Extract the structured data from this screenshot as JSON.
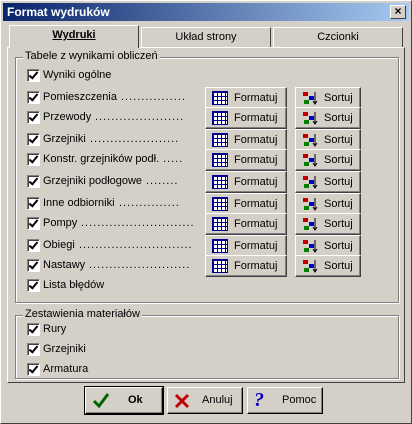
{
  "window": {
    "title": "Format wydruków",
    "close_glyph": "×"
  },
  "tabs": [
    {
      "label": "Wydruki"
    },
    {
      "label": "Układ strony"
    },
    {
      "label": "Czcionki"
    }
  ],
  "group_tables": {
    "title": "Tabele z wynikami obliczeń",
    "rows": [
      {
        "label": "Wyniki ogólne",
        "checked": true,
        "buttons": false
      },
      {
        "label": "Pomieszczenia",
        "checked": true,
        "buttons": true,
        "dots": "................"
      },
      {
        "label": "Przewody",
        "checked": true,
        "buttons": true,
        "dots": "......................"
      },
      {
        "label": "Grzejniki",
        "checked": true,
        "buttons": true,
        "dots": "......................"
      },
      {
        "label": "Konstr. grzejników podł.",
        "checked": true,
        "buttons": true,
        "dots": "....."
      },
      {
        "label": "Grzejniki podłogowe",
        "checked": true,
        "buttons": true,
        "dots": "........"
      },
      {
        "label": "Inne odbiorniki",
        "checked": true,
        "buttons": true,
        "dots": "..............."
      },
      {
        "label": "Pompy",
        "checked": true,
        "buttons": true,
        "dots": "............................"
      },
      {
        "label": "Obiegi",
        "checked": true,
        "buttons": true,
        "dots": "............................"
      },
      {
        "label": "Nastawy",
        "checked": true,
        "buttons": true,
        "dots": "........................."
      },
      {
        "label": "Lista błędów",
        "checked": true,
        "buttons": false
      }
    ],
    "format_label": "Formatuj",
    "sort_label": "Sortuj"
  },
  "group_materials": {
    "title": "Zestawienia materiałów",
    "rows": [
      {
        "label": "Rury",
        "checked": true
      },
      {
        "label": "Grzejniki",
        "checked": true
      },
      {
        "label": "Armatura",
        "checked": true
      }
    ]
  },
  "footer": {
    "ok_label": "Ok",
    "cancel_label": "Anuluj",
    "help_label": "Pomoc",
    "ok_icon": "checkmark-icon",
    "cancel_icon": "red-x-icon",
    "help_icon": "question-mark-icon"
  }
}
